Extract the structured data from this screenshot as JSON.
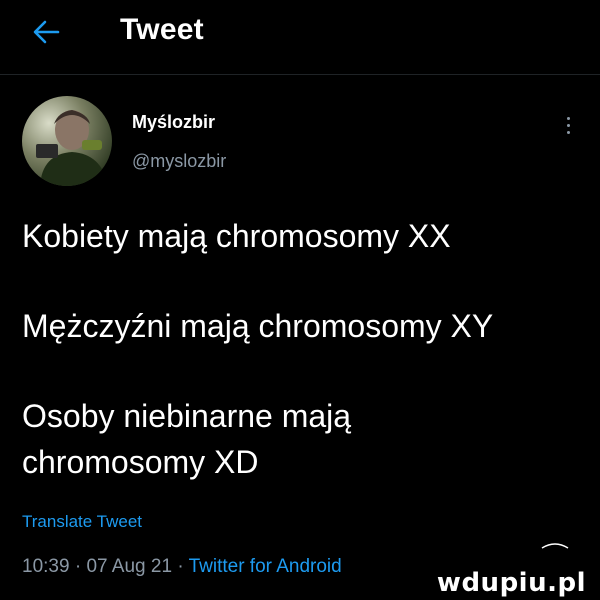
{
  "header": {
    "title": "Tweet",
    "back_icon": "arrow-left-icon"
  },
  "author": {
    "display_name": "Myślozbir",
    "handle": "@myslozbir",
    "more_icon": "more-vertical-icon"
  },
  "tweet": {
    "lines": [
      "Kobiety mają chromosomy XX",
      "Mężczyźni mają chromosomy XY",
      "Osoby niebinarne mają",
      "chromosomy XD"
    ],
    "translate_label": "Translate Tweet",
    "time": "10:39",
    "date": "07 Aug 21",
    "source": "Twitter for Android"
  },
  "watermark": {
    "text": "wdupiu.pl"
  },
  "colors": {
    "background": "#000000",
    "text": "#ffffff",
    "muted": "#8b98a5",
    "accent": "#1d9bf0",
    "divider": "#1f2326"
  }
}
